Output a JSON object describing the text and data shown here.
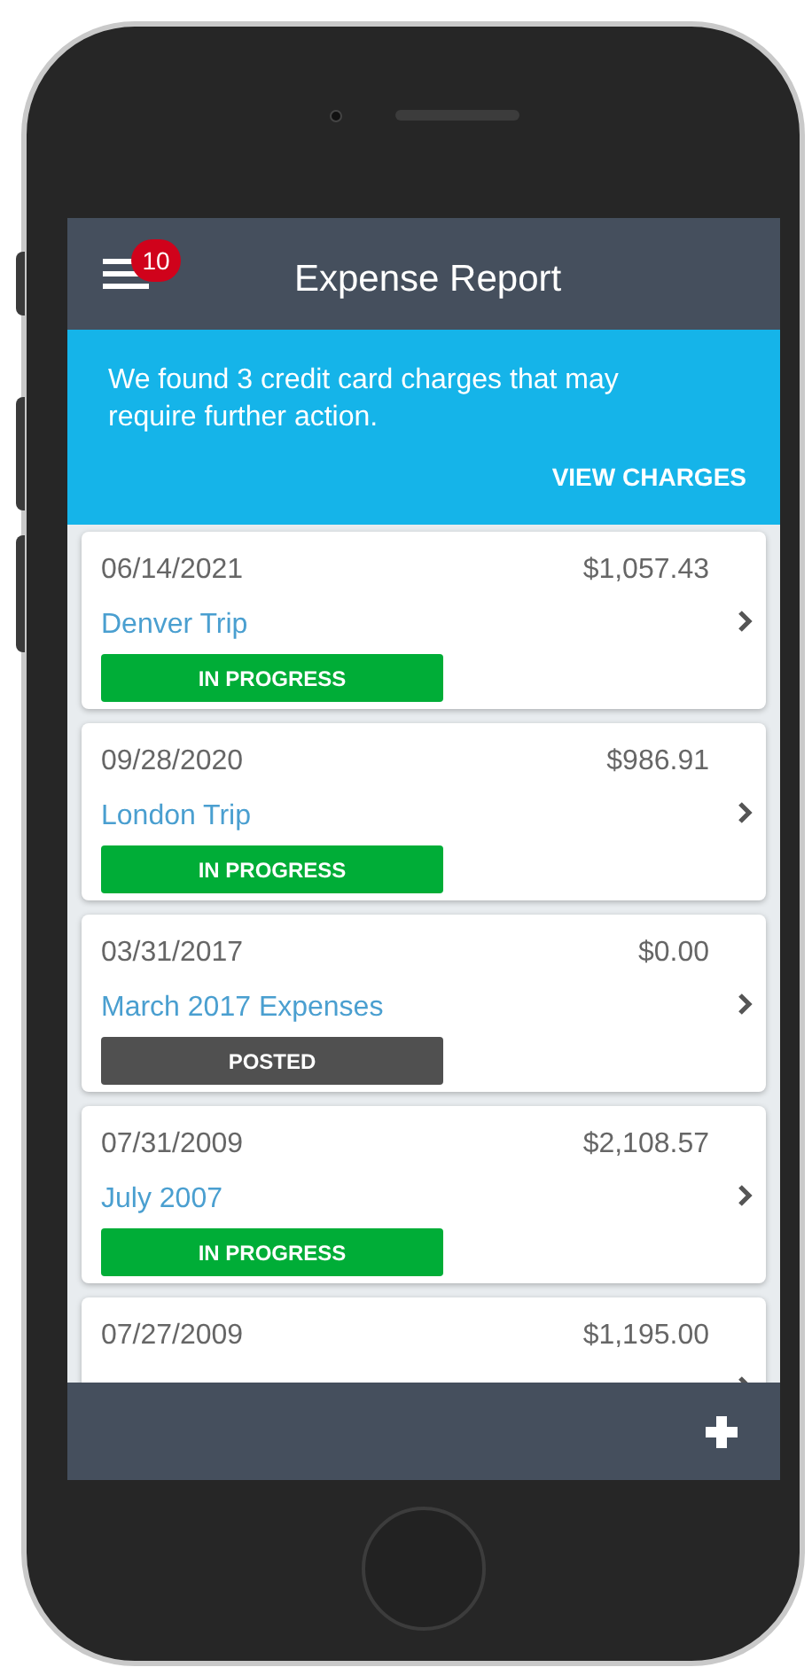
{
  "header": {
    "title": "Expense Report",
    "notification_count": "10"
  },
  "banner": {
    "message": "We found 3 credit card charges that may require further action.",
    "action": "VIEW CHARGES"
  },
  "reports": [
    {
      "date": "06/14/2021",
      "amount": "$1,057.43",
      "title": "Denver Trip",
      "status": {
        "kind": "in_progress",
        "label": "IN PROGRESS"
      }
    },
    {
      "date": "09/28/2020",
      "amount": "$986.91",
      "title": "London Trip",
      "status": {
        "kind": "in_progress",
        "label": "IN PROGRESS"
      }
    },
    {
      "date": "03/31/2017",
      "amount": "$0.00",
      "title": "March 2017 Expenses",
      "status": {
        "kind": "posted",
        "label": "POSTED"
      }
    },
    {
      "date": "07/31/2009",
      "amount": "$2,108.57",
      "title": "July 2007",
      "status": {
        "kind": "in_progress",
        "label": "IN PROGRESS"
      }
    },
    {
      "date": "07/27/2009",
      "amount": "$1,195.00"
    }
  ]
}
